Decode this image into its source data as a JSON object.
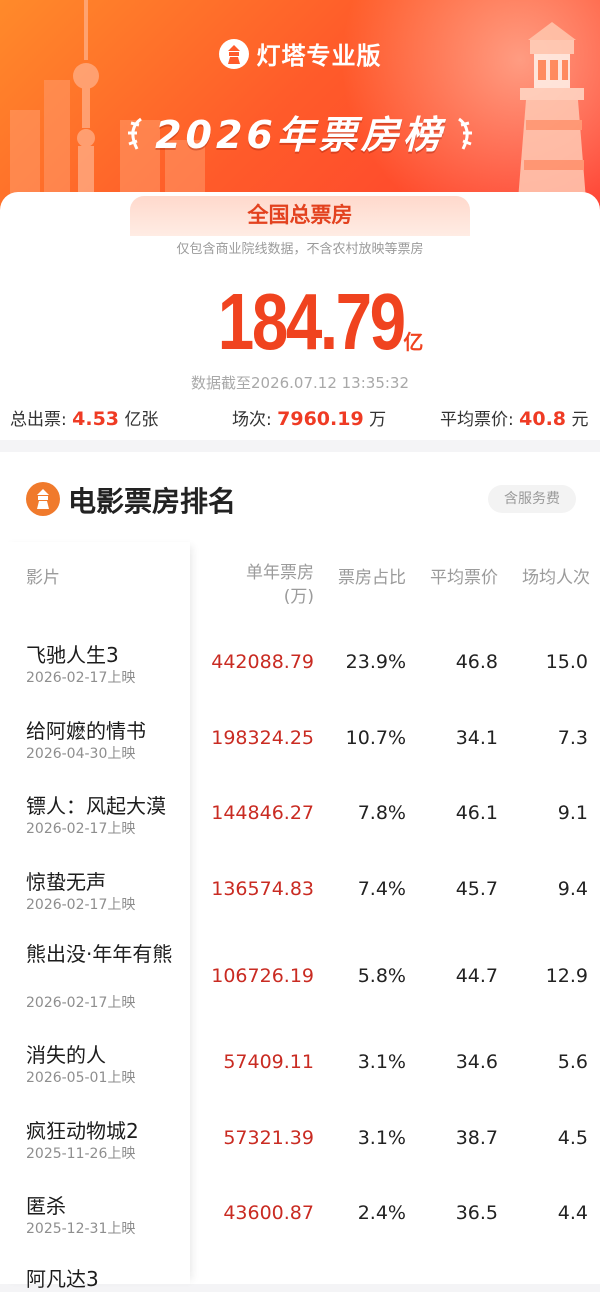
{
  "header": {
    "brand": "灯塔专业版",
    "title": "2026年票房榜"
  },
  "summary": {
    "tab_label": "全国总票房",
    "note": "仅包含商业院线数据，不含农村放映等票房",
    "total": "184.79",
    "total_unit": "亿",
    "as_of": "数据截至2026.07.12 13:35:32",
    "tickets_label": "总出票:",
    "tickets_value": "4.53",
    "tickets_unit": "亿张",
    "shows_label": "场次:",
    "shows_value": "7960.19",
    "shows_unit": "万",
    "avg_price_label": "平均票价:",
    "avg_price_value": "40.8",
    "avg_price_unit": "元"
  },
  "ranking": {
    "title": "电影票房排名",
    "fee_badge": "含服务费",
    "columns": {
      "film": "影片",
      "box_office": "单年票房",
      "box_office_unit": "(万)",
      "share": "票房占比",
      "avg_price": "平均票价",
      "avg_attendance": "场均人次"
    },
    "rows": [
      {
        "name": "飞驰人生3",
        "date": "2026-02-17上映",
        "box": "442088.79",
        "share": "23.9%",
        "price": "46.8",
        "att": "15.0"
      },
      {
        "name": "给阿嬷的情书",
        "date": "2026-04-30上映",
        "box": "198324.25",
        "share": "10.7%",
        "price": "34.1",
        "att": "7.3"
      },
      {
        "name": "镖人：风起大漠",
        "date": "2026-02-17上映",
        "box": "144846.27",
        "share": "7.8%",
        "price": "46.1",
        "att": "9.1"
      },
      {
        "name": "惊蛰无声",
        "date": "2026-02-17上映",
        "box": "136574.83",
        "share": "7.4%",
        "price": "45.7",
        "att": "9.4"
      },
      {
        "name": "熊出没·年年有熊",
        "date": "2026-02-17上映",
        "box": "106726.19",
        "share": "5.8%",
        "price": "44.7",
        "att": "12.9"
      },
      {
        "name": "消失的人",
        "date": "2026-05-01上映",
        "box": "57409.11",
        "share": "3.1%",
        "price": "34.6",
        "att": "5.6"
      },
      {
        "name": "疯狂动物城2",
        "date": "2025-11-26上映",
        "box": "57321.39",
        "share": "3.1%",
        "price": "38.7",
        "att": "4.5"
      },
      {
        "name": "匿杀",
        "date": "2025-12-31上映",
        "box": "43600.87",
        "share": "2.4%",
        "price": "36.5",
        "att": "4.4"
      },
      {
        "name": "阿凡达3",
        "date": "",
        "box": "",
        "share": "",
        "price": "",
        "att": ""
      }
    ]
  }
}
